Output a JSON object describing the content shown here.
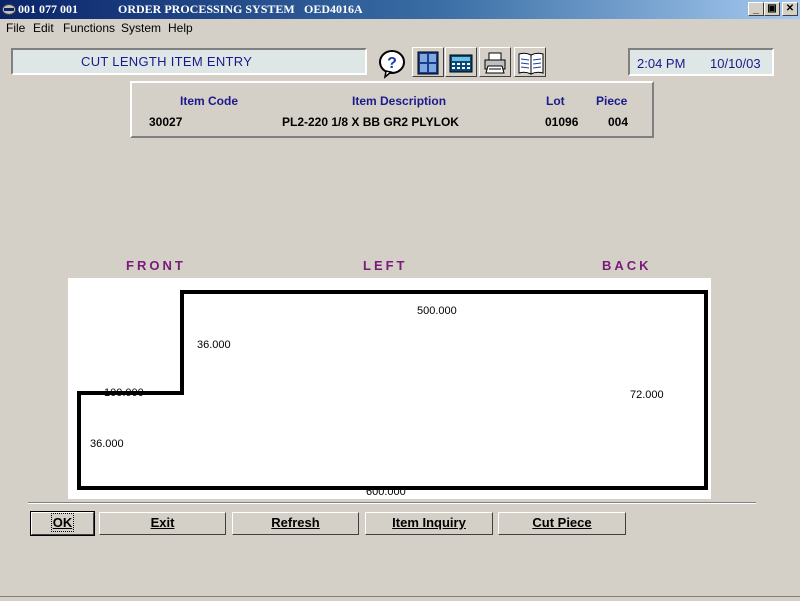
{
  "window": {
    "title_id": "001 077 001",
    "title_app": "ORDER PROCESSING SYSTEM",
    "title_code": "OED4016A",
    "minimize": "_",
    "restore": "▣",
    "close": "✕"
  },
  "menu": [
    "File",
    "Edit",
    "Functions",
    "System",
    "Help"
  ],
  "form": {
    "title": "CUT LENGTH ITEM ENTRY",
    "time": "2:04 PM",
    "date": "10/10/03"
  },
  "toolbar_icons": [
    "help-icon",
    "window-icon",
    "calculator-icon",
    "printer-icon",
    "book-icon"
  ],
  "item": {
    "code_label": "Item Code",
    "desc_label": "Item Description",
    "lot_label": "Lot",
    "piece_label": "Piece",
    "code": "30027",
    "desc": "PL2-220 1/8 X BB GR2 PLYLOK",
    "lot": "01096",
    "piece": "004"
  },
  "orientation": {
    "front": "FRONT",
    "left": "LEFT",
    "back": "BACK"
  },
  "dimensions": {
    "top": "500.000",
    "step_height": "36.000",
    "step_width": "100.000",
    "lower_left": "36.000",
    "right": "72.000",
    "bottom": "600.000"
  },
  "buttons": {
    "ok": "OK",
    "exit": "Exit",
    "refresh": "Refresh",
    "item_inquiry": "Item Inquiry",
    "cut_piece": "Cut Piece"
  }
}
